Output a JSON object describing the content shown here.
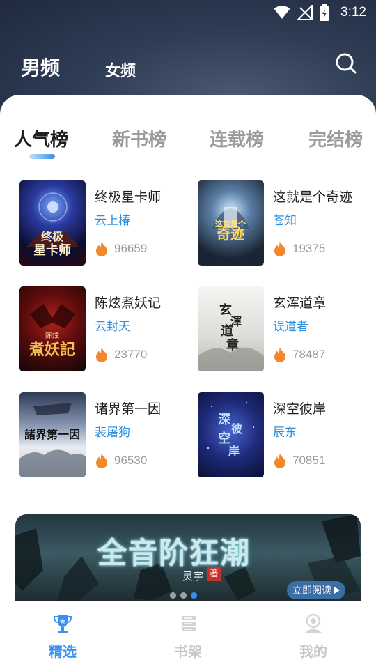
{
  "status_bar": {
    "time": "3:12",
    "icons": [
      "wifi-icon",
      "no-signal-icon",
      "battery-charging-icon"
    ]
  },
  "header": {
    "tabs": [
      {
        "label": "男频",
        "active": true
      },
      {
        "label": "女频",
        "active": false
      }
    ],
    "search_icon": "search-icon"
  },
  "rank_tabs": [
    {
      "label": "人气榜",
      "active": true
    },
    {
      "label": "新书榜",
      "active": false
    },
    {
      "label": "连载榜",
      "active": false
    },
    {
      "label": "完结榜",
      "active": false
    }
  ],
  "books": [
    {
      "title": "终极星卡师",
      "author": "云上椿",
      "heat": "96659"
    },
    {
      "title": "这就是个奇迹",
      "author": "苍知",
      "heat": "19375"
    },
    {
      "title": "陈炫煮妖记",
      "author": "云封天",
      "heat": "23770"
    },
    {
      "title": "玄浑道章",
      "author": "误道者",
      "heat": "78487"
    },
    {
      "title": "诸界第一因",
      "author": "裴屠狗",
      "heat": "96530"
    },
    {
      "title": "深空彼岸",
      "author": "辰东",
      "heat": "70851"
    }
  ],
  "banner": {
    "title": "全音阶狂潮",
    "author": "灵宇",
    "author_tag": "著",
    "button_label": "立即阅读",
    "slide_count": 3,
    "active_slide": 2
  },
  "bottom_nav": [
    {
      "label": "精选",
      "icon": "trophy-icon",
      "active": true
    },
    {
      "label": "书架",
      "icon": "bookshelf-icon",
      "active": false
    },
    {
      "label": "我的",
      "icon": "profile-icon",
      "active": false
    }
  ],
  "colors": {
    "accent": "#3a8ff2",
    "author": "#2a8fe0",
    "header_bg": "#2f3d55",
    "flame": "#f5862a"
  }
}
